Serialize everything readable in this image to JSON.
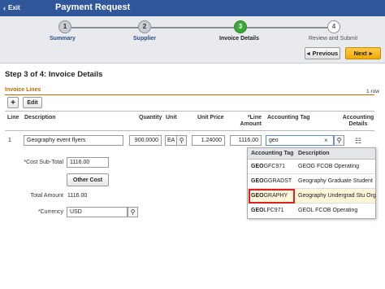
{
  "header": {
    "exit_label": "Exit",
    "title": "Payment Request"
  },
  "steps": [
    {
      "number": "1",
      "label": "Summary",
      "state": "done"
    },
    {
      "number": "2",
      "label": "Supplier",
      "state": "done"
    },
    {
      "number": "3",
      "label": "Invoice Details",
      "state": "active"
    },
    {
      "number": "4",
      "label": "Review and Submit",
      "state": "pending"
    }
  ],
  "nav": {
    "previous_label": "Previous",
    "next_label": "Next"
  },
  "page": {
    "step_title": "Step 3 of 4: Invoice Details",
    "section_title": "Invoice Lines",
    "row_count": "1 row"
  },
  "toolbar": {
    "add_label": "+",
    "edit_label": "Edit"
  },
  "table": {
    "columns": {
      "line": "Line",
      "description": "Description",
      "quantity": "Quantity",
      "unit": "Unit",
      "unit_price": "Unit Price",
      "line_amount": "*Line Amount",
      "accounting_tag": "Accounting Tag",
      "accounting_details": "Accounting Details"
    },
    "row": {
      "line": "1",
      "description": "Geography event flyers",
      "quantity": "900.0000",
      "unit": "EA",
      "unit_price": "1.24000",
      "line_amount": "1116.00",
      "accounting_tag": "geo"
    }
  },
  "totals": {
    "subtotal_label": "*Cost Sub-Total",
    "subtotal_value": "1116.00",
    "other_cost_label": "Other Cost",
    "total_label": "Total Amount",
    "total_value": "1116.00",
    "currency_label": "*Currency",
    "currency_value": "USD"
  },
  "suggestions": {
    "headers": {
      "tag": "Accounting Tag",
      "description": "Description"
    },
    "items": [
      {
        "bold": "GEO",
        "rest": "GFC971",
        "description": "GEOG FCOB Operating",
        "selected": false
      },
      {
        "bold": "GEO",
        "rest": "GGRADST",
        "description": "Geography Graduate Student",
        "selected": false
      },
      {
        "bold": "GEO",
        "rest": "GRAPHY",
        "description": "Geography Undergrad Stu Org",
        "selected": true
      },
      {
        "bold": "GEO",
        "rest": "LFC971",
        "description": "GEOL FCOB Operating",
        "selected": false
      }
    ]
  },
  "colors": {
    "header_bg": "#30579a",
    "active_step": "#3ba73b",
    "next_button": "#f0a900",
    "section_title": "#c06b00",
    "selection_outline": "#e02020"
  }
}
